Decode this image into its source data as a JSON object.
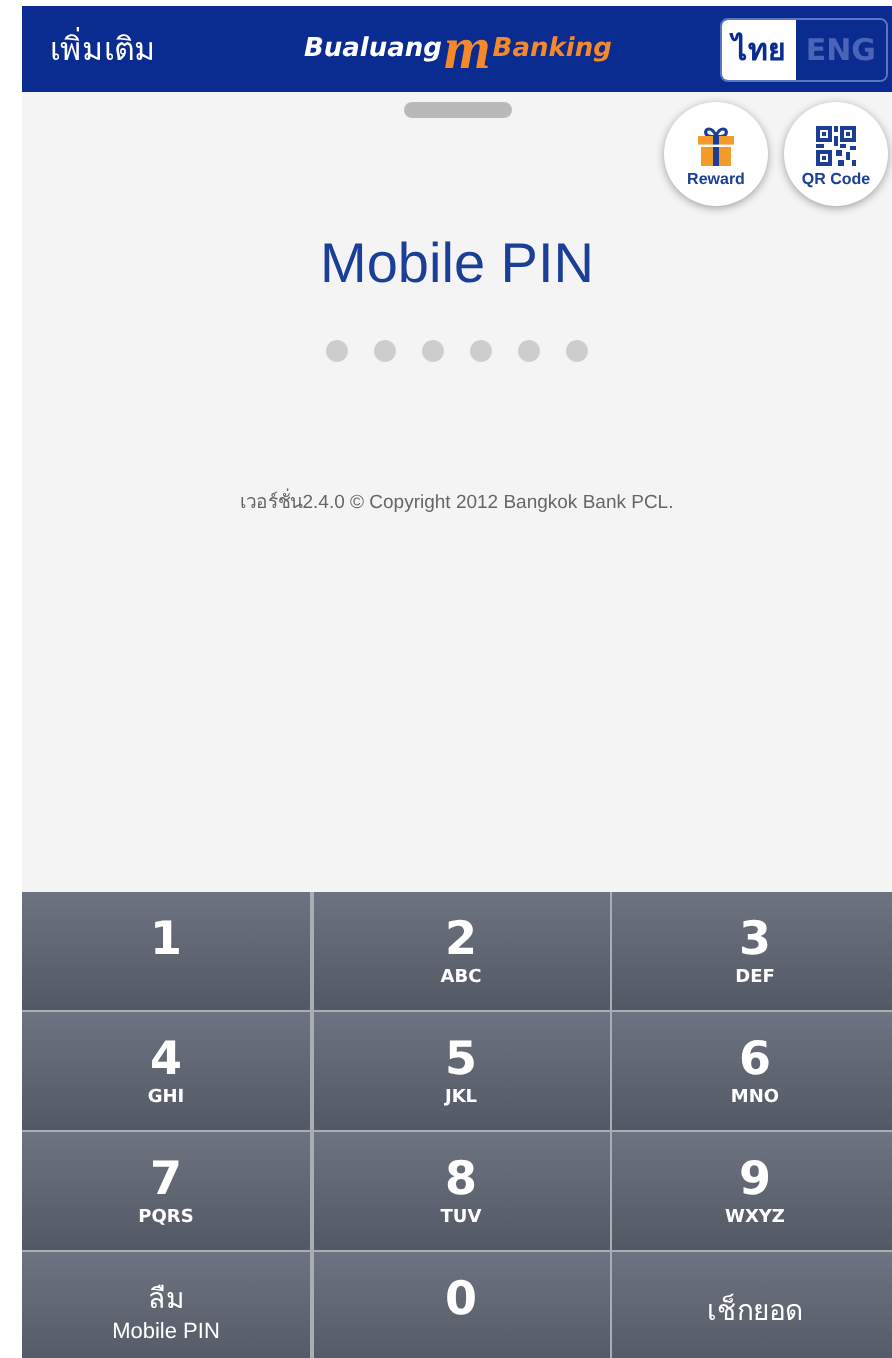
{
  "header": {
    "menu": "เพิ่มเติม",
    "logo": {
      "left": "Bualuang",
      "mark": "m",
      "right": "Banking"
    },
    "languages": [
      {
        "label": "ไทย",
        "selected": true
      },
      {
        "label": "ENG",
        "selected": false
      }
    ]
  },
  "shortcuts": [
    {
      "kind": "gift",
      "label": "Reward"
    },
    {
      "kind": "qr",
      "label": "QR Code"
    }
  ],
  "title": "Mobile PIN",
  "pin_dots": [
    {
      "filled": false
    },
    {
      "filled": false
    },
    {
      "filled": false
    },
    {
      "filled": false
    },
    {
      "filled": false
    },
    {
      "filled": false
    }
  ],
  "version": "เวอร์ชั่น2.4.0 © Copyright 2012 Bangkok Bank PCL.",
  "keypad": [
    {
      "kind": "digit",
      "digit": "1"
    },
    {
      "kind": "digit",
      "digit": "2",
      "letters": "ABC"
    },
    {
      "kind": "digit",
      "digit": "3",
      "letters": "DEF"
    },
    {
      "kind": "digit",
      "digit": "4",
      "letters": "GHI"
    },
    {
      "kind": "digit",
      "digit": "5",
      "letters": "JKL"
    },
    {
      "kind": "digit",
      "digit": "6",
      "letters": "MNO"
    },
    {
      "kind": "digit",
      "digit": "7",
      "letters": "PQRS"
    },
    {
      "kind": "digit",
      "digit": "8",
      "letters": "TUV"
    },
    {
      "kind": "digit",
      "digit": "9",
      "letters": "WXYZ"
    },
    {
      "kind": "action",
      "label": "ลืม",
      "sublabel": "Mobile PIN"
    },
    {
      "kind": "digit",
      "digit": "0"
    },
    {
      "kind": "action",
      "label": "เช็กยอด"
    }
  ]
}
